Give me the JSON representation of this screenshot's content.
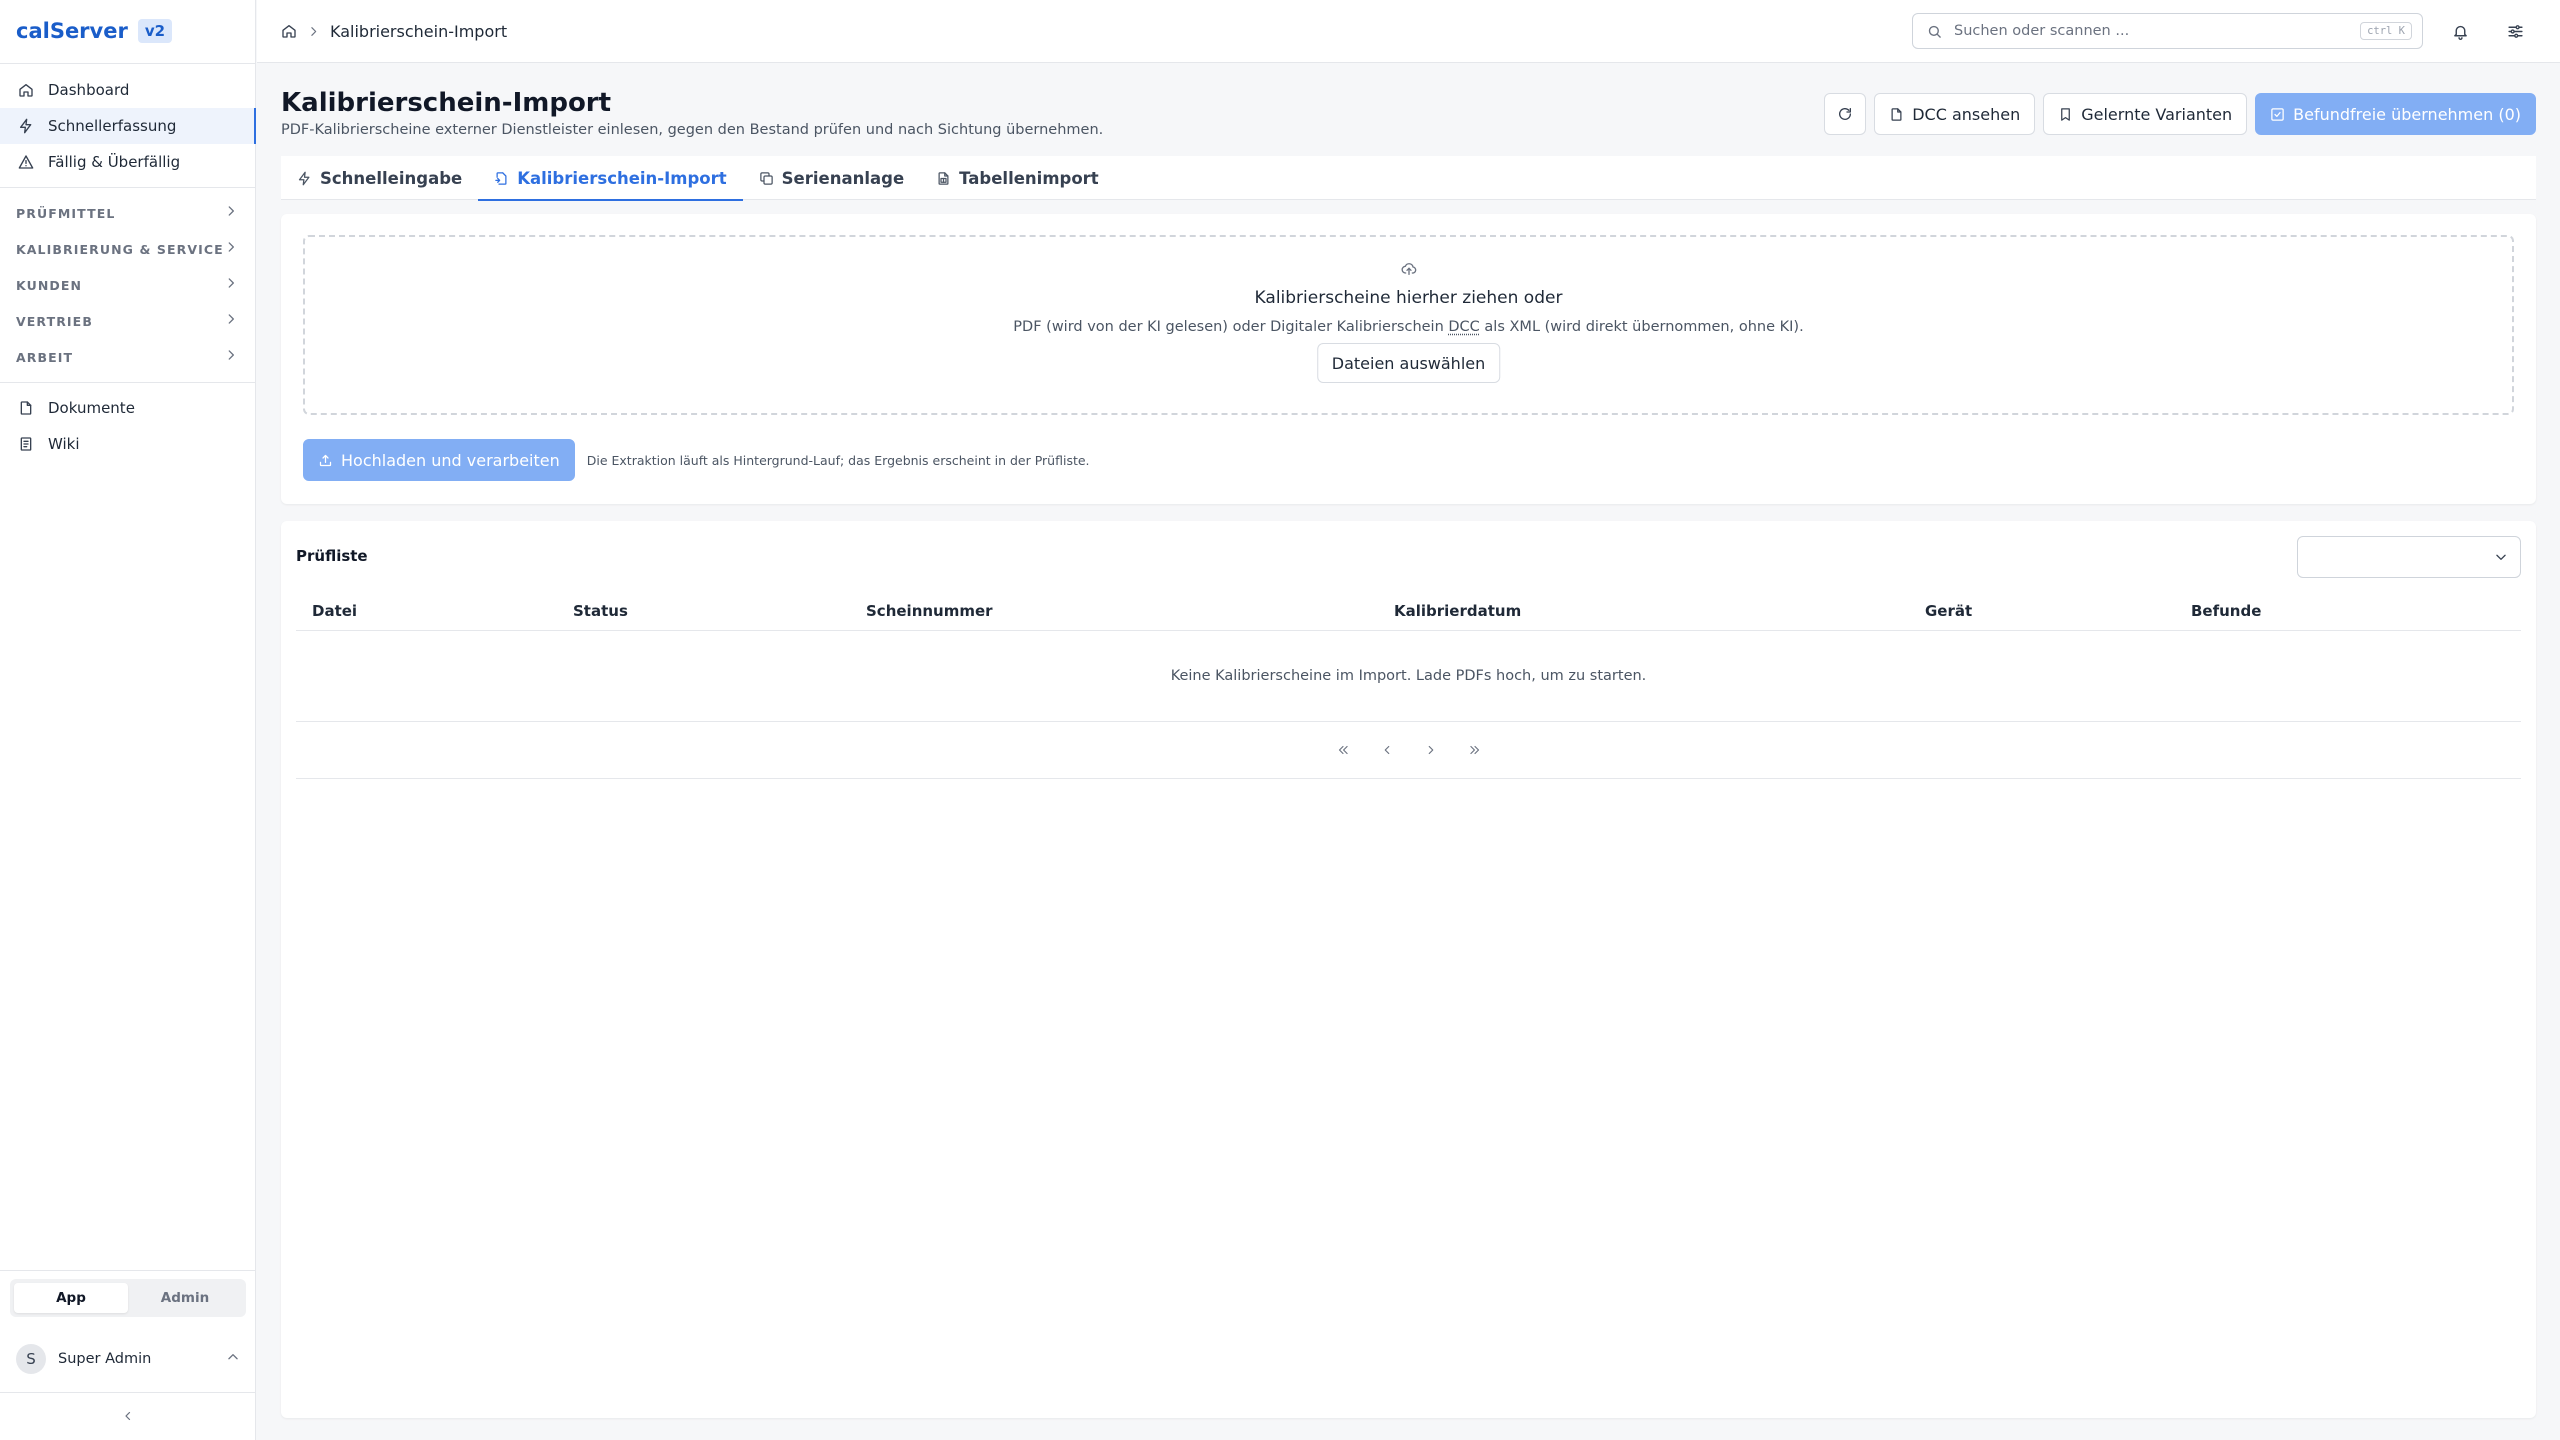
{
  "app": {
    "name": "calServer",
    "version": "v2"
  },
  "sidebar": {
    "items": [
      {
        "label": "Dashboard",
        "icon": "home-icon"
      },
      {
        "label": "Schnellerfassung",
        "icon": "bolt-icon",
        "active": true
      },
      {
        "label": "Fällig & Überfällig",
        "icon": "warning-icon"
      }
    ],
    "groups": [
      "PRÜFMITTEL",
      "KALIBRIERUNG & SERVICE",
      "KUNDEN",
      "VERTRIEB",
      "ARBEIT"
    ],
    "extra": [
      {
        "label": "Dokumente",
        "icon": "document-icon"
      },
      {
        "label": "Wiki",
        "icon": "book-icon"
      }
    ],
    "mode": {
      "app": "App",
      "admin": "Admin",
      "selected": "App"
    },
    "user": {
      "initial": "S",
      "name": "Super Admin"
    }
  },
  "topbar": {
    "breadcrumb": "Kalibrierschein-Import",
    "search_placeholder": "Suchen oder scannen ...",
    "shortcut": "ctrl K"
  },
  "page": {
    "title": "Kalibrierschein-Import",
    "subtitle": "PDF-Kalibrierscheine externer Dienstleister einlesen, gegen den Bestand prüfen und nach Sichtung übernehmen.",
    "actions": {
      "dcc": "DCC ansehen",
      "variants": "Gelernte Varianten",
      "accept": "Befundfreie übernehmen (0)"
    }
  },
  "tabs": [
    {
      "label": "Schnelleingabe",
      "icon": "bolt-icon"
    },
    {
      "label": "Kalibrierschein-Import",
      "icon": "file-import-icon",
      "active": true
    },
    {
      "label": "Serienanlage",
      "icon": "copy-icon"
    },
    {
      "label": "Tabellenimport",
      "icon": "file-table-icon"
    }
  ],
  "upload": {
    "title": "Kalibrierscheine hierher ziehen oder",
    "hint_before": "PDF (wird von der KI gelesen) oder Digitaler Kalibrierschein ",
    "hint_abbr": "DCC",
    "hint_after": " als XML (wird direkt übernommen, ohne KI).",
    "choose_button": "Dateien auswählen",
    "upload_button": "Hochladen und verarbeiten",
    "note": "Die Extraktion läuft als Hintergrund-Lauf; das Ergebnis erscheint in der Prüfliste."
  },
  "checklist": {
    "title": "Prüfliste",
    "filter_value": "",
    "columns": [
      "Datei",
      "Status",
      "Scheinnummer",
      "Kalibrierdatum",
      "Gerät",
      "Befunde"
    ],
    "empty": "Keine Kalibrierscheine im Import. Lade PDFs hoch, um zu starten."
  },
  "colors": {
    "accent": "#2e6fe0",
    "primary_button": "#82aef4",
    "brand": "#1a5dc9"
  }
}
